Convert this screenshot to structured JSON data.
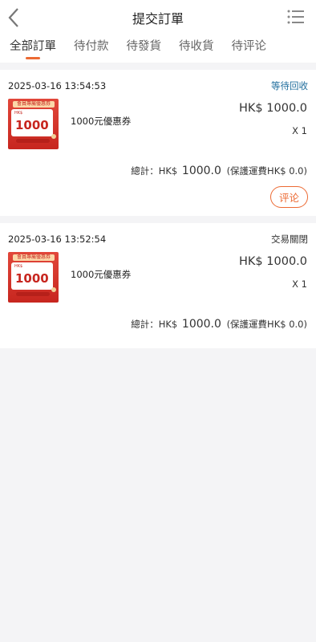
{
  "header": {
    "title": "提交訂單"
  },
  "tabs": [
    "全部訂單",
    "待付款",
    "待發貨",
    "待收貨",
    "待评论"
  ],
  "orders": [
    {
      "time": "2025-03-16 13:54:53",
      "status": "等待回收",
      "item_name": "1000元優惠券",
      "price": "HK$ 1000.0",
      "qty": "X 1",
      "total_label": "總計：HK$",
      "total_amount": "1000.0",
      "shipping": "(保護運費HK$ 0.0)",
      "action": "评论",
      "thumb_banner": "會員專屬優惠券",
      "thumb_currency": "HK$",
      "thumb_amount": "1000"
    },
    {
      "time": "2025-03-16 13:52:54",
      "status": "交易關閉",
      "item_name": "1000元優惠券",
      "price": "HK$ 1000.0",
      "qty": "X 1",
      "total_label": "總計：HK$",
      "total_amount": "1000.0",
      "shipping": "(保護運費HK$ 0.0)",
      "thumb_banner": "會員專屬優惠券",
      "thumb_currency": "HK$",
      "thumb_amount": "1000"
    }
  ],
  "colors": {
    "accent": "#ec6a33",
    "status_pending": "#1f6d9c",
    "background": "#f4f4f6"
  }
}
